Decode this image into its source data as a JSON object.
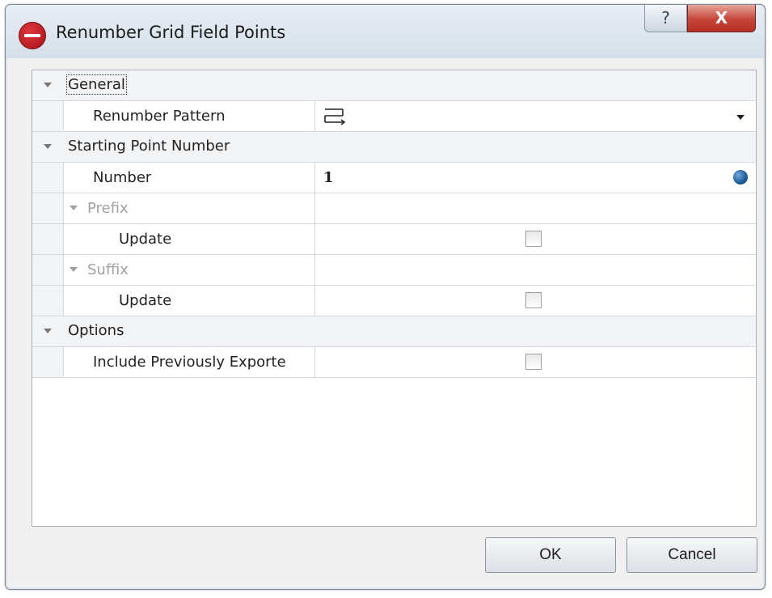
{
  "window": {
    "title": "Renumber Grid Field Points",
    "help_glyph": "?",
    "close_glyph": "X"
  },
  "grid": {
    "general": {
      "label": "General",
      "renumber_pattern_label": "Renumber Pattern",
      "renumber_pattern_icon": "pattern-rows-icon"
    },
    "starting_point": {
      "label": "Starting Point Number",
      "number_label": "Number",
      "number_value": "1",
      "prefix_label": "Prefix",
      "prefix_update_label": "Update",
      "prefix_update_checked": false,
      "suffix_label": "Suffix",
      "suffix_update_label": "Update",
      "suffix_update_checked": false
    },
    "options": {
      "label": "Options",
      "include_previously_exported_label": "Include Previously Exporte",
      "include_previously_exported_checked": false
    }
  },
  "buttons": {
    "ok": "OK",
    "cancel": "Cancel"
  }
}
